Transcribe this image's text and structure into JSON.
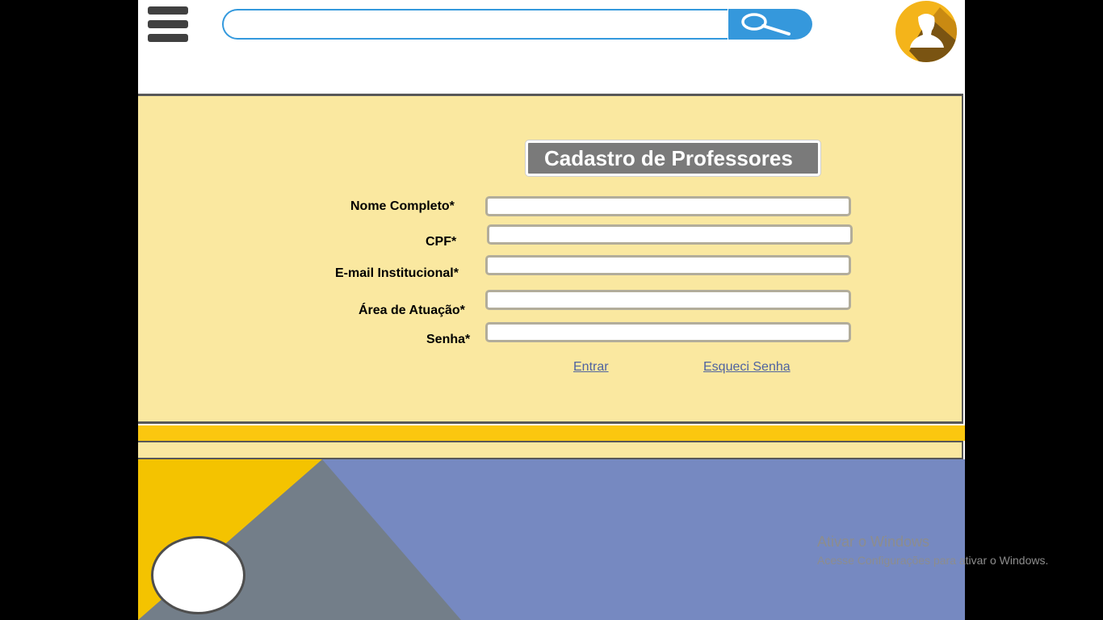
{
  "header": {
    "search_placeholder": ""
  },
  "form": {
    "title": "Cadastro de Professores",
    "fields": [
      {
        "label": "Nome  Completo*",
        "value": ""
      },
      {
        "label": "CPF*",
        "value": ""
      },
      {
        "label": "E-mail  Institucional*",
        "value": ""
      },
      {
        "label": "Área de Atuação*",
        "value": ""
      },
      {
        "label": "Senha*",
        "value": ""
      }
    ],
    "links": {
      "login": "Entrar",
      "forgot_password": "Esqueci Senha"
    }
  },
  "watermark": {
    "title": "Ativar o Windows",
    "subtitle": "Acesse Configurações para ativar o Windows."
  },
  "colors": {
    "search_accent": "#3598dc",
    "panel_bg": "#fae8a0",
    "stripe_yellow": "#fbc70f",
    "avatar_bg": "#f4b41a",
    "title_box": "#7a7a7a",
    "link": "#4f63a0",
    "bottom_blue": "#7689c1",
    "bottom_gray": "#737e89",
    "bottom_yellow": "#f4c300"
  },
  "icons": {
    "menu": "hamburger-icon",
    "search": "magnifier-icon",
    "profile": "user-icon"
  }
}
